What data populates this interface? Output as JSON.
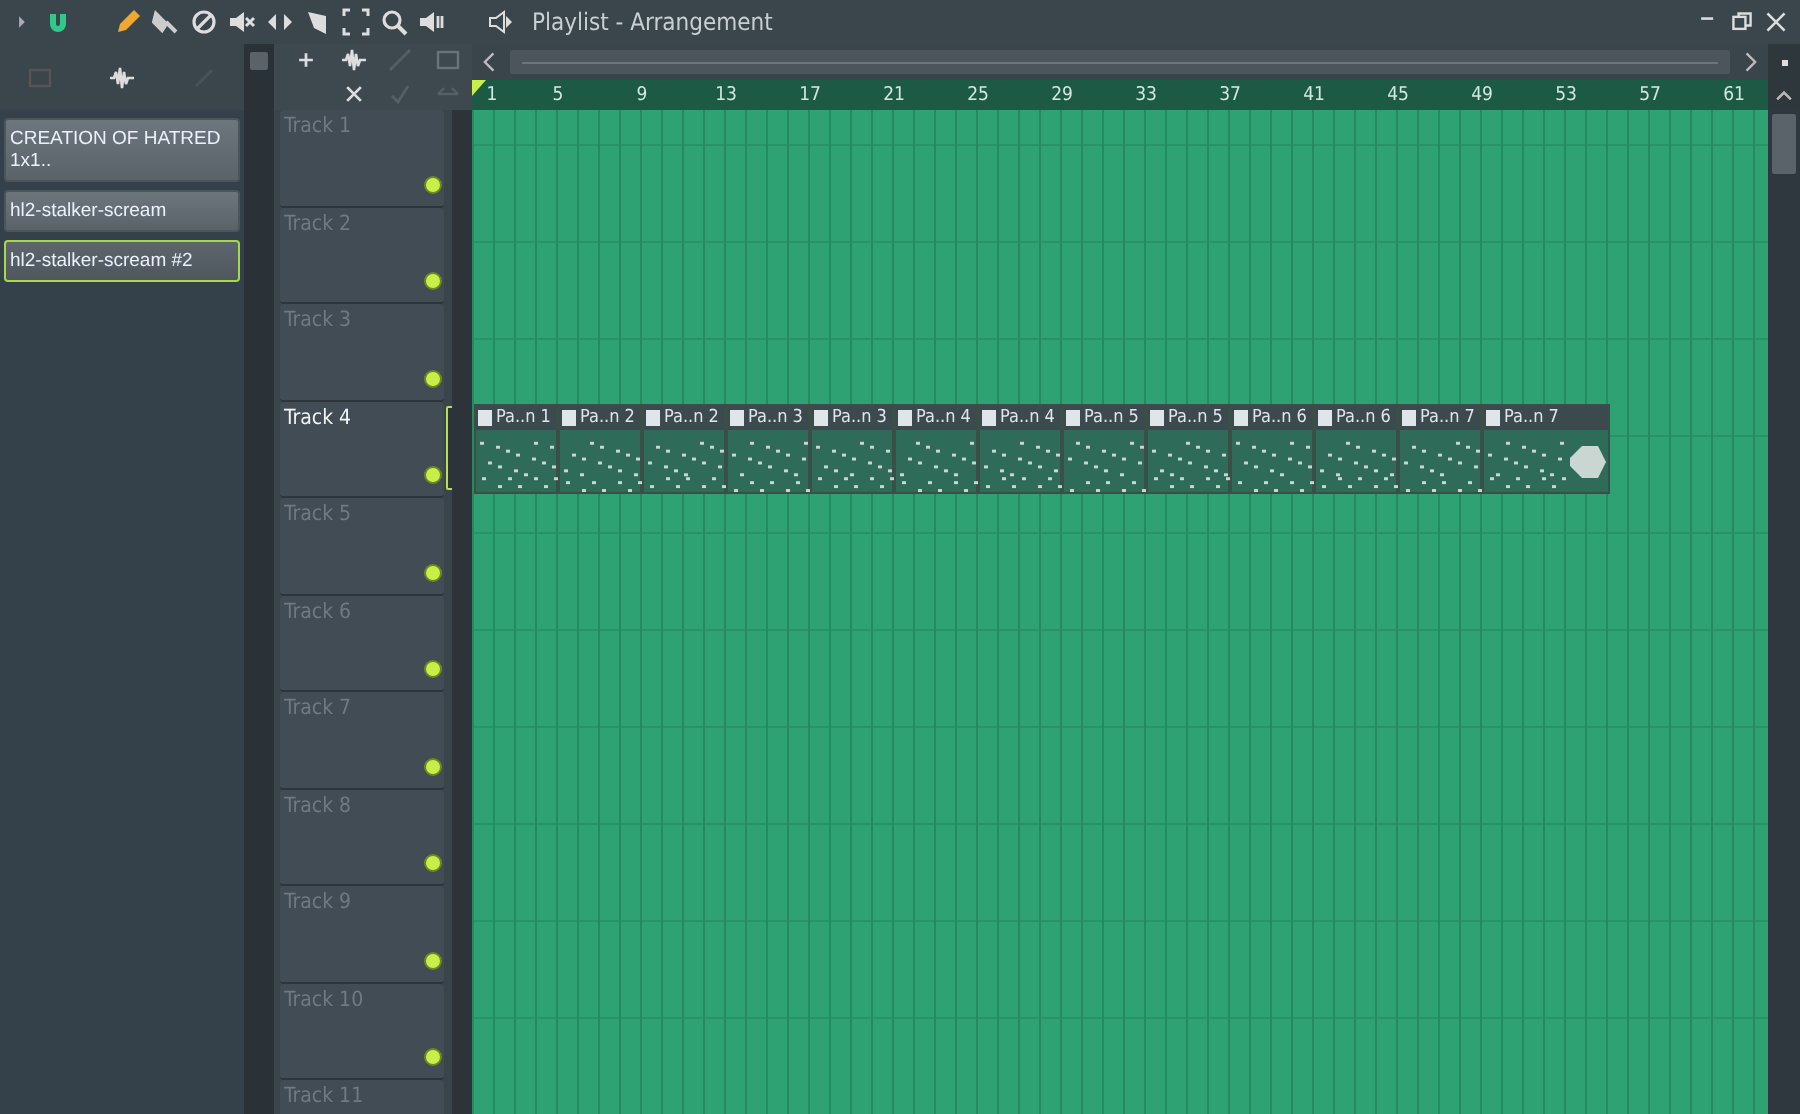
{
  "toolbar": {
    "title": "Playlist - Arrangement"
  },
  "browser": {
    "items": [
      {
        "label": "CREATION OF HATRED  1x1..",
        "selected": false
      },
      {
        "label": "hl2-stalker-scream",
        "selected": false
      },
      {
        "label": "hl2-stalker-scream #2",
        "selected": true
      }
    ]
  },
  "ruler": {
    "bars": [
      "1",
      "5",
      "9",
      "13",
      "17",
      "21",
      "25",
      "29",
      "33",
      "37",
      "41",
      "45",
      "49",
      "53",
      "57",
      "61"
    ]
  },
  "tracks": [
    {
      "name": "Track 1",
      "selected": false
    },
    {
      "name": "Track 2",
      "selected": false
    },
    {
      "name": "Track 3",
      "selected": false
    },
    {
      "name": "Track 4",
      "selected": true,
      "clips": [
        {
          "label": "Pa..n 1"
        },
        {
          "label": "Pa..n 2"
        },
        {
          "label": "Pa..n 2"
        },
        {
          "label": "Pa..n 3"
        },
        {
          "label": "Pa..n 3"
        },
        {
          "label": "Pa..n 4"
        },
        {
          "label": "Pa..n 4"
        },
        {
          "label": "Pa..n 5"
        },
        {
          "label": "Pa..n 5"
        },
        {
          "label": "Pa..n 6"
        },
        {
          "label": "Pa..n 6"
        },
        {
          "label": "Pa..n 7"
        },
        {
          "label": "Pa..n 7"
        }
      ]
    },
    {
      "name": "Track 5",
      "selected": false
    },
    {
      "name": "Track 6",
      "selected": false
    },
    {
      "name": "Track 7",
      "selected": false
    },
    {
      "name": "Track 8",
      "selected": false
    },
    {
      "name": "Track 9",
      "selected": false
    },
    {
      "name": "Track 10",
      "selected": false
    },
    {
      "name": "Track 11",
      "selected": false
    }
  ]
}
